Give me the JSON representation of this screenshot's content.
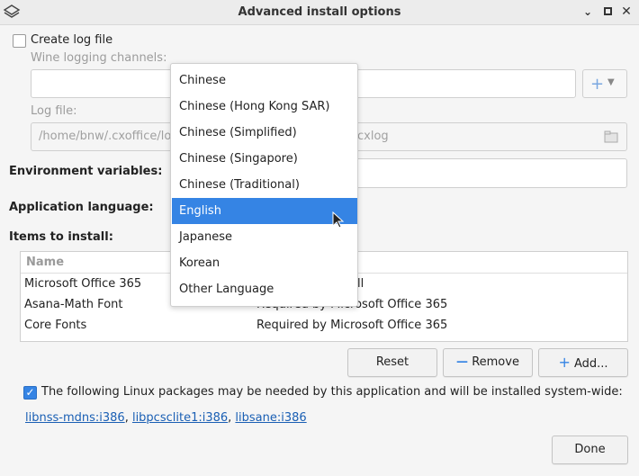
{
  "window": {
    "title": "Advanced install options"
  },
  "log": {
    "create_label": "Create log file",
    "create_checked": false,
    "channels_label": "Wine logging channels:",
    "channels_value": "",
    "file_label": "Log file:",
    "file_value_left": "/home/bnw/.cxoffice/lo",
    "file_value_right": "cxlog"
  },
  "env": {
    "label": "Environment variables:"
  },
  "language": {
    "label": "Application language:",
    "options": [
      "Chinese",
      "Chinese (Hong Kong SAR)",
      "Chinese (Simplified)",
      "Chinese (Singapore)",
      "Chinese (Traditional)",
      "English",
      "Japanese",
      "Korean",
      "Other Language"
    ],
    "selected_index": 5
  },
  "items": {
    "label": "Items to install:",
    "col_name": "Name",
    "rows": [
      {
        "name": "Microsoft Office 365",
        "note": "ll"
      },
      {
        "name": "Asana-Math Font",
        "note": "Required by Microsoft Office 365"
      },
      {
        "name": "Core Fonts",
        "note": "Required by Microsoft Office 365"
      }
    ]
  },
  "buttons": {
    "reset": "Reset",
    "remove": "Remove",
    "add": "Add...",
    "done": "Done"
  },
  "packages": {
    "checked": true,
    "text": "The following Linux packages may be needed by this application and will be installed system-wide:",
    "links": [
      "libnss-mdns:i386",
      "libpcsclite1:i386",
      "libsane:i386"
    ]
  },
  "colors": {
    "accent": "#3584e4",
    "link": "#1a5fb4"
  }
}
